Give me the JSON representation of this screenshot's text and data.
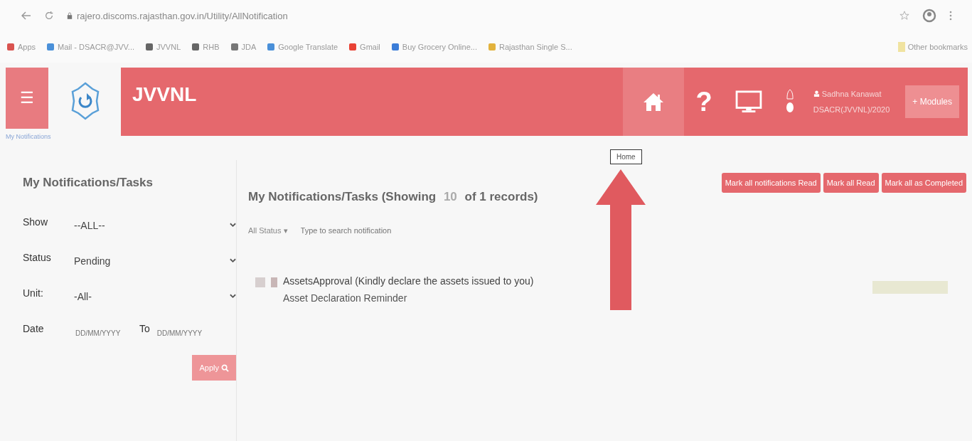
{
  "browser": {
    "url": "rajero.discoms.rajasthan.gov.in/Utility/AllNotification",
    "bookmarks": [
      {
        "label": "Apps",
        "color": "#d9534f"
      },
      {
        "label": "Mail - DSACR@JVV...",
        "color": "#4a90d9"
      },
      {
        "label": "JVVNL",
        "color": "#666666"
      },
      {
        "label": "RHB",
        "color": "#666666"
      },
      {
        "label": "JDA",
        "color": "#777777"
      },
      {
        "label": "Google Translate",
        "color": "#4a90d9"
      },
      {
        "label": "Gmail",
        "color": "#e94235"
      },
      {
        "label": "Buy Grocery Online...",
        "color": "#3b7dd8"
      },
      {
        "label": "Rajasthan Single S...",
        "color": "#e2b23c"
      }
    ],
    "other_bookmarks": "Other bookmarks"
  },
  "header": {
    "menu_icon": "☰",
    "breadcrumb": "My Notifications",
    "brand": "JVVNL",
    "help": "?",
    "user": "Sadhna Kanawat",
    "role": "DSACR(JVVNL)/2020",
    "modules": "+ Modules",
    "tooltip": "Home"
  },
  "filters": {
    "title": "My Notifications/Tasks",
    "fields": [
      {
        "label": "Show",
        "value": "--ALL--"
      },
      {
        "label": "Status",
        "value": "Pending"
      },
      {
        "label": "Unit:",
        "value": "-All-"
      }
    ],
    "date_label": "Date",
    "from_placeholder": "DD/MM/YYYY",
    "to_label": "To",
    "to_placeholder": "DD/MM/YYYY",
    "apply": "Apply"
  },
  "main": {
    "title": "My Notifications/Tasks (Showing ",
    "count": "10",
    "title_end": " of 1 records)",
    "status_filter": "All Status ▾",
    "search_placeholder": "Type to search notification",
    "actions": [
      "Mark all notifications Read",
      "Mark all Read",
      "Mark all as Completed"
    ],
    "notifications": [
      {
        "title": "AssetsApproval (Kindly declare the assets issued to you)",
        "subtitle": "Asset Declaration Reminder",
        "read": false
      }
    ]
  }
}
